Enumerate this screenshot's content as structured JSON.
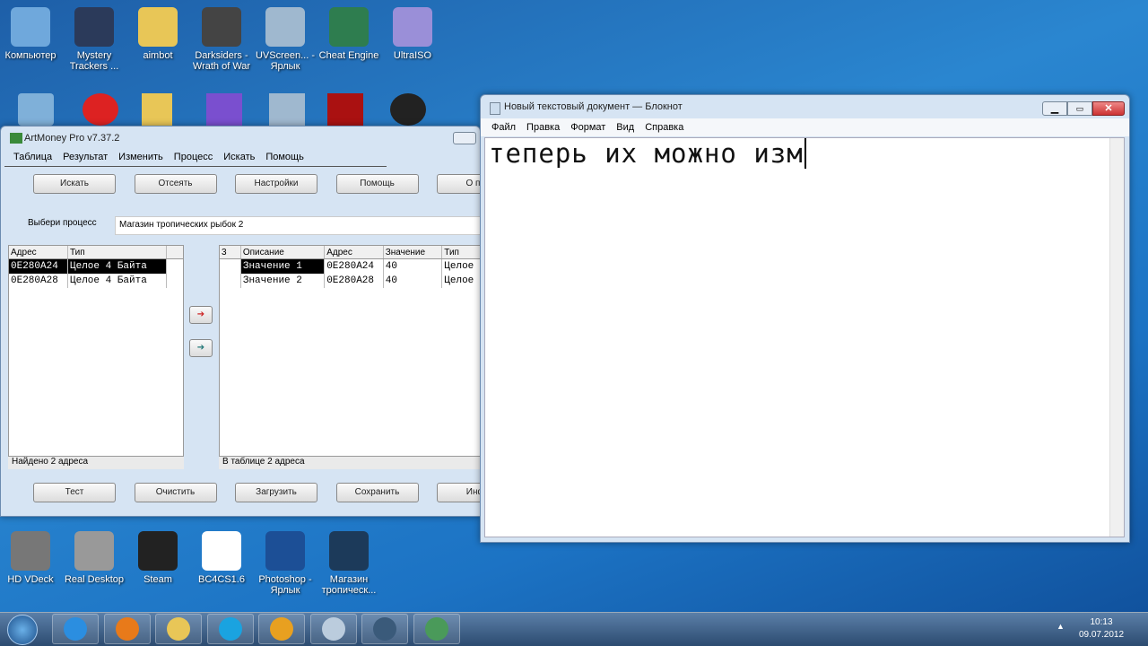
{
  "desktop": {
    "top_icons": [
      {
        "label": "Компьютер",
        "color": "#6fa8dc"
      },
      {
        "label": "Mystery Trackers ...",
        "color": "#2b3a5a"
      },
      {
        "label": "aimbot",
        "color": "#e8c657"
      },
      {
        "label": "Darksiders - Wrath of War",
        "color": "#444"
      },
      {
        "label": "UVScreen... - Ярлык",
        "color": "#9fb8cf"
      },
      {
        "label": "Cheat Engine",
        "color": "#2e7d4f"
      },
      {
        "label": "UltraISO",
        "color": "#9a8fd8"
      }
    ],
    "bottom_icons": [
      {
        "label": "HD VDeck",
        "color": "#777"
      },
      {
        "label": "Real Desktop",
        "color": "#999"
      },
      {
        "label": "Steam",
        "color": "#222"
      },
      {
        "label": "BC4CS1.6",
        "color": "#fff"
      },
      {
        "label": "Photoshop - Ярлык",
        "color": "#1c4f96"
      },
      {
        "label": "Магазин тропическ...",
        "color": "#1c3a5a"
      }
    ]
  },
  "artmoney": {
    "title": "ArtMoney Pro v7.37.2",
    "menu": [
      "Таблица",
      "Результат",
      "Изменить",
      "Процесс",
      "Искать",
      "Помощь"
    ],
    "toolbar": [
      "Искать",
      "Отсеять",
      "Настройки",
      "Помощь",
      "О про"
    ],
    "process_label": "Выбери процесс",
    "process_value": "Магазин тропических рыбок 2",
    "left_headers": [
      "Адрес",
      "Тип"
    ],
    "left_rows": [
      [
        "0E280A24",
        "Целое 4 Байта"
      ],
      [
        "0E280A28",
        "Целое 4 Байта"
      ]
    ],
    "right_headers": [
      "3",
      "Описание",
      "Адрес",
      "Значение",
      "Тип"
    ],
    "right_rows": [
      [
        "",
        "Значение 1",
        "0E280A24",
        "40",
        "Целое"
      ],
      [
        "",
        "Значение 2",
        "0E280A28",
        "40",
        "Целое"
      ]
    ],
    "left_status": "Найдено 2 адреса",
    "right_status": "В таблице 2 адреса",
    "bottom_buttons": [
      "Тест",
      "Очистить",
      "Загрузить",
      "Сохранить",
      "Инфо"
    ]
  },
  "notepad": {
    "title": "Новый текстовый документ — Блокнот",
    "menu": [
      "Файл",
      "Правка",
      "Формат",
      "Вид",
      "Справка"
    ],
    "text": "теперь их можно изм"
  },
  "taskbar": {
    "time": "10:13",
    "date": "09.07.2012"
  }
}
